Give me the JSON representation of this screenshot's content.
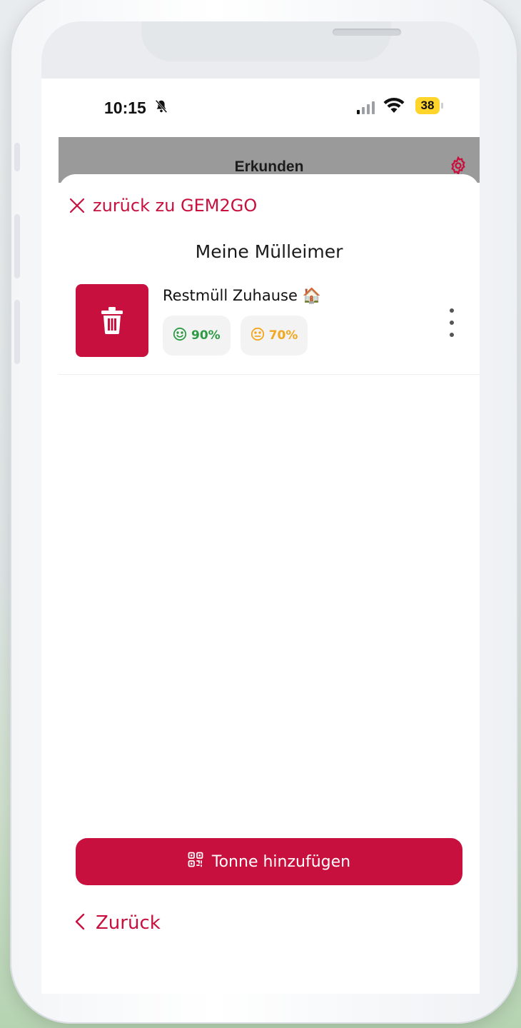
{
  "status_bar": {
    "time": "10:15",
    "battery": "38"
  },
  "app_bar": {
    "title": "Erkunden"
  },
  "sheet": {
    "close_label": "zurück zu GEM2GO",
    "title": "Meine Mülleimer",
    "bins": [
      {
        "name": "Restmüll Zuhause",
        "emoji": "🏠",
        "badges": [
          {
            "value": "90%",
            "mood": "happy",
            "color": "#2e9a45"
          },
          {
            "value": "70%",
            "mood": "neutral",
            "color": "#f2a71f"
          }
        ]
      }
    ],
    "add_button_label": "Tonne hinzufügen",
    "back_label": "Zurück"
  },
  "colors": {
    "accent": "#c8103f",
    "appbar": "#9a9a9a"
  },
  "icons": [
    "bell-slash-icon",
    "signal-icon",
    "wifi-icon",
    "battery-icon",
    "gear-icon",
    "close-icon",
    "trash-icon",
    "smile-icon",
    "neutral-face-icon",
    "more-vertical-icon",
    "qr-code-icon",
    "chevron-left-icon"
  ]
}
